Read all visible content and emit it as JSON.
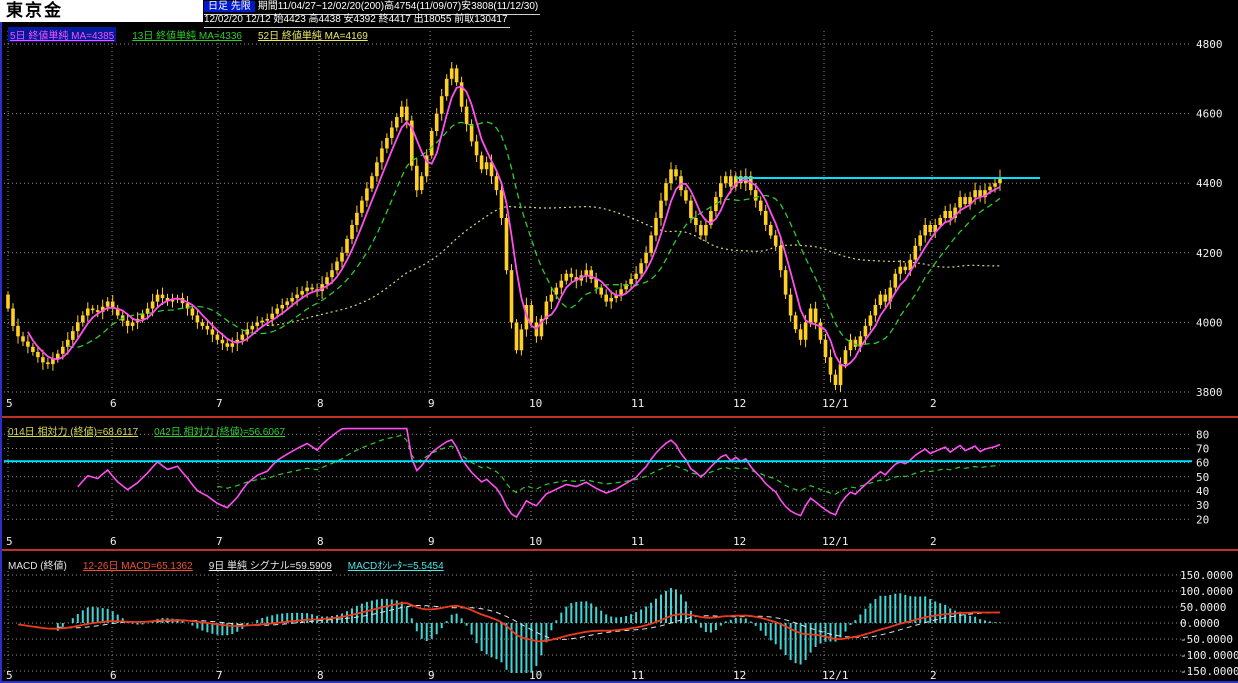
{
  "header": {
    "title": "東京金",
    "chart_type": "日足 先限",
    "period_info": "期間11/04/27~12/02/20(200)高4754(11/09/07)安3808(11/12/30)",
    "quote_info": "12/02/20 12/12 始4423 高4438 安4392 終4417 出18055 前取130417"
  },
  "colors": {
    "candle": "#ffd024",
    "ma5": "#ff4df2",
    "ma13": "#2ecc2e",
    "ma52": "#d8d878",
    "cyan": "#00e0ff",
    "macd": "#f03a1e",
    "signal": "#e4e4e4",
    "hist": "#3ed6d6",
    "grid": "#8f8f8f",
    "separator": "#c03226",
    "frame_blue": "#2b31c8"
  },
  "price_panel": {
    "legend": [
      {
        "label": "5日 終値単純 MA=4385",
        "color": "#ff4df2",
        "highlight": true
      },
      {
        "label": "13日 終値単純 MA=4336",
        "color": "#2ecc2e"
      },
      {
        "label": "52日 終値単純 MA=4169",
        "color": "#e8e864"
      }
    ],
    "y_labels": [
      "4800",
      "4600",
      "4400",
      "4200",
      "4000",
      "3800"
    ],
    "resistance_level": 4415
  },
  "rsi_panel": {
    "legend": [
      {
        "label": "014日 相対力 (終値)=68.6117",
        "color": "#d8d84a"
      },
      {
        "label": "042日 相対力 (終値)=56.6067",
        "color": "#2ecc2e"
      }
    ],
    "y_labels": [
      "80",
      "70",
      "60",
      "50",
      "40",
      "30",
      "20"
    ],
    "threshold_level": 61
  },
  "macd_panel": {
    "legend": [
      {
        "label": "MACD (終値)",
        "color": "#e8e8e8",
        "underline": false
      },
      {
        "label": "12-26日 MACD=65.1362",
        "color": "#f05030"
      },
      {
        "label": "9日 単純 シグナル=59.5909",
        "color": "#e8e8e8"
      },
      {
        "label": "MACDｵｼﾚｰﾀｰ=5.5454",
        "color": "#4ce8e8"
      }
    ],
    "y_labels": [
      "150.0000",
      "100.0000",
      "50.0000",
      "0.0000",
      "-50.0000",
      "-100.0000",
      "-150.0000"
    ]
  },
  "x_axis": {
    "labels": [
      "5",
      "6",
      "7",
      "8",
      "9",
      "10",
      "11",
      "12",
      "12/1",
      "2"
    ],
    "positions": [
      8,
      112,
      218,
      319,
      430,
      531,
      633,
      735,
      824,
      932
    ]
  },
  "chart_data": {
    "type": "candlestick",
    "title": "東京金 日足 先限",
    "panels": [
      {
        "name": "price",
        "ylim": [
          3800,
          4800
        ],
        "overlays": [
          "MA5",
          "MA13",
          "MA52"
        ],
        "resistance_level": 4415
      },
      {
        "name": "rsi",
        "ylim": [
          20,
          80
        ],
        "series": [
          "RSI14",
          "RSI42"
        ],
        "threshold": 61
      },
      {
        "name": "macd",
        "ylim": [
          -150,
          150
        ],
        "series": [
          "MACD 12-26",
          "Signal 9",
          "Oscillator"
        ]
      }
    ],
    "closes": [
      4040,
      3990,
      3960,
      3945,
      3930,
      3915,
      3900,
      3885,
      3880,
      3895,
      3910,
      3930,
      3950,
      3975,
      4000,
      4020,
      4040,
      4035,
      4030,
      4045,
      4060,
      4040,
      4020,
      4005,
      3990,
      4000,
      4010,
      4025,
      4040,
      4060,
      4080,
      4070,
      4060,
      4065,
      4070,
      4055,
      4040,
      4020,
      4000,
      3990,
      3980,
      3965,
      3950,
      3940,
      3930,
      3940,
      3950,
      3965,
      3980,
      3990,
      4000,
      4005,
      4010,
      4025,
      4040,
      4050,
      4060,
      4070,
      4080,
      4090,
      4100,
      4095,
      4090,
      4110,
      4130,
      4150,
      4175,
      4200,
      4240,
      4280,
      4315,
      4350,
      4385,
      4420,
      4460,
      4500,
      4530,
      4560,
      4590,
      4620,
      4580,
      4450,
      4380,
      4420,
      4480,
      4550,
      4600,
      4650,
      4700,
      4730,
      4690,
      4620,
      4570,
      4520,
      4480,
      4440,
      4460,
      4420,
      4380,
      4300,
      4150,
      4000,
      3920,
      3980,
      4050,
      4000,
      3960,
      4010,
      4060,
      4080,
      4100,
      4120,
      4140,
      4130,
      4120,
      4135,
      4150,
      4125,
      4100,
      4080,
      4060,
      4070,
      4080,
      4095,
      4110,
      4125,
      4140,
      4170,
      4200,
      4250,
      4300,
      4350,
      4400,
      4440,
      4420,
      4380,
      4350,
      4300,
      4280,
      4250,
      4280,
      4320,
      4360,
      4400,
      4420,
      4390,
      4420,
      4400,
      4420,
      4380,
      4350,
      4320,
      4280,
      4250,
      4220,
      4150,
      4080,
      4020,
      3980,
      3950,
      4000,
      4040,
      4000,
      3950,
      3900,
      3850,
      3820,
      3880,
      3920,
      3950,
      3930,
      3960,
      3990,
      4020,
      4050,
      4080,
      4060,
      4100,
      4140,
      4160,
      4150,
      4180,
      4220,
      4250,
      4280,
      4260,
      4280,
      4300,
      4320,
      4300,
      4330,
      4360,
      4340,
      4360,
      4380,
      4360,
      4380,
      4390,
      4400,
      4417
    ]
  }
}
